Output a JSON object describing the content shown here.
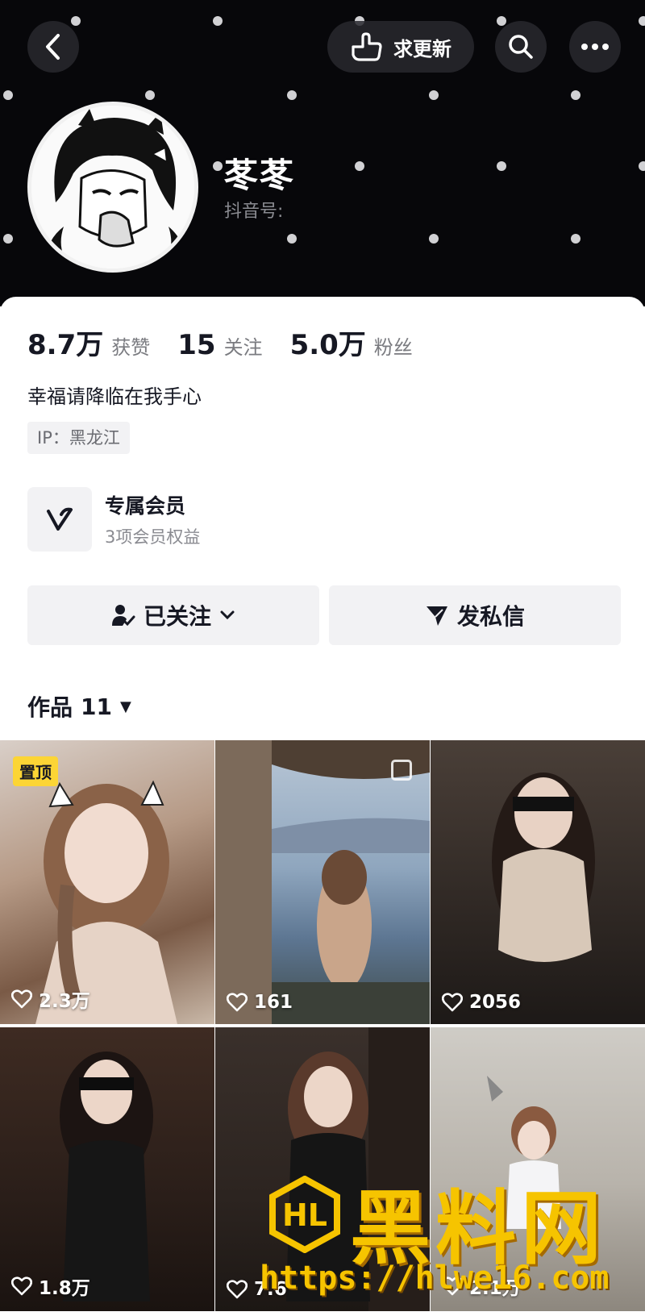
{
  "header": {
    "update_button_label": "求更新",
    "nickname": "苳苳",
    "douyin_id_label": "抖音号:"
  },
  "profile": {
    "stats": [
      {
        "value": "8.7万",
        "label": "获赞"
      },
      {
        "value": "15",
        "label": "关注"
      },
      {
        "value": "5.0万",
        "label": "粉丝"
      }
    ],
    "bio": "幸福请降临在我手心",
    "ip_tag": "IP：黑龙江",
    "membership": {
      "title": "专属会员",
      "subtitle": "3项会员权益"
    },
    "follow_button_label": "已关注",
    "message_button_label": "发私信"
  },
  "works": {
    "tab_label": "作品",
    "count": "11",
    "pin_badge": "置顶",
    "tiles": [
      {
        "likes": "2.3万",
        "pinned": true
      },
      {
        "likes": "161"
      },
      {
        "likes": "2056"
      },
      {
        "likes": "1.8万"
      },
      {
        "likes": "7.6"
      },
      {
        "likes": "2.1万"
      }
    ]
  },
  "watermark": {
    "logo_text": "HL",
    "title": "黑料网",
    "url": "https://hlwe16.com"
  },
  "colors": {
    "header_bg": "#07070a",
    "card_bg": "#ffffff",
    "button_bg": "#f2f2f4",
    "pin_badge": "#fcd535",
    "watermark": "#f6c400"
  }
}
